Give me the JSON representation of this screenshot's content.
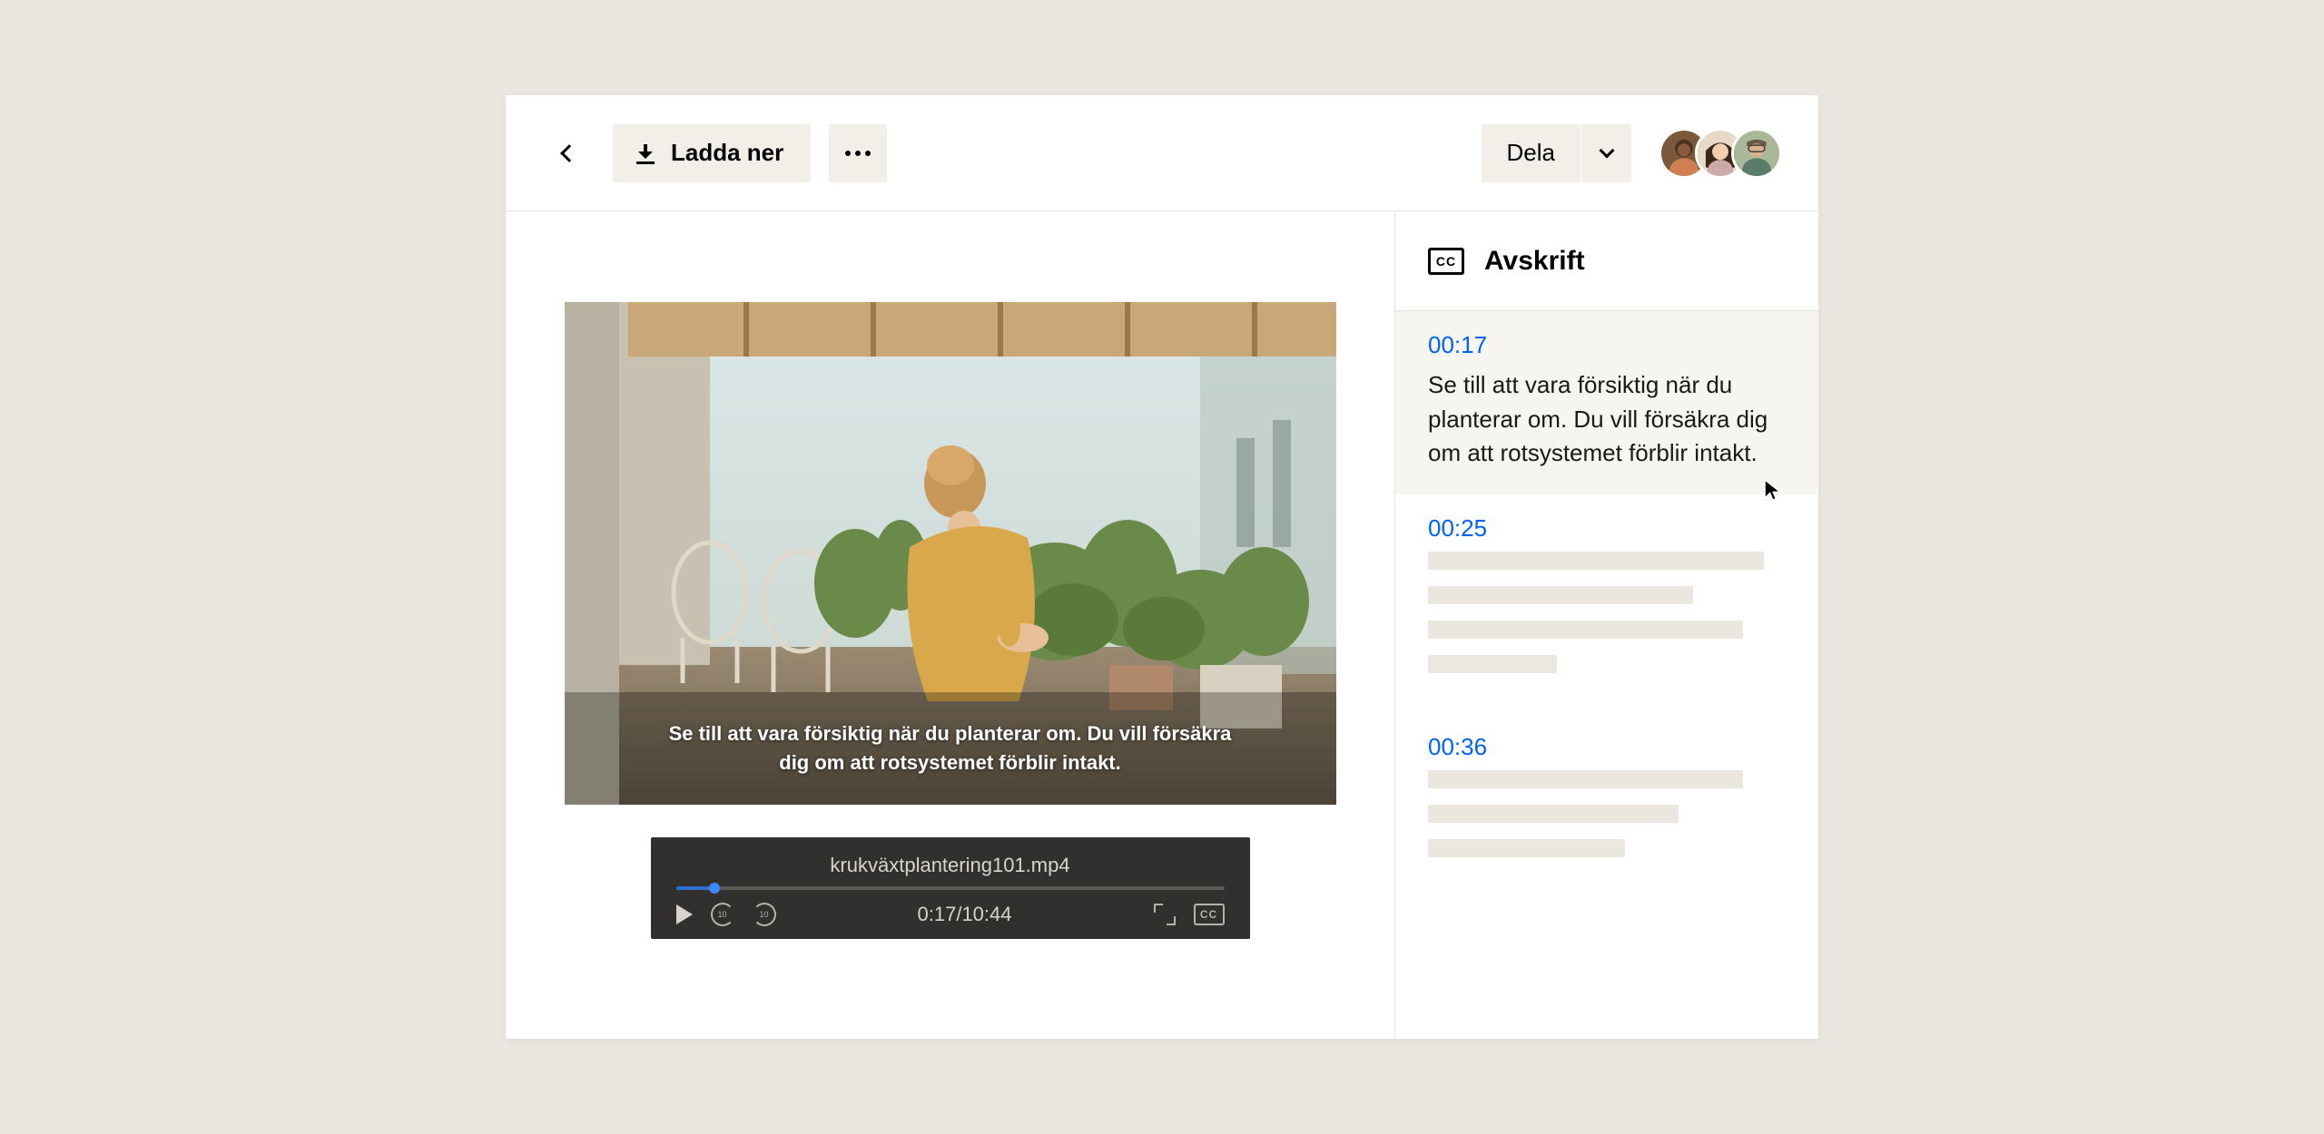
{
  "header": {
    "download_label": "Ladda ner",
    "share_label": "Dela"
  },
  "video": {
    "caption": "Se till att vara försiktig när du planterar om. Du vill försäkra dig om att rotsystemet förblir intakt.",
    "filename": "krukväxtplantering101.mp4",
    "current_time": "0:17",
    "duration": "10:44",
    "progress_pct": 7,
    "skip_seconds": "10"
  },
  "transcript": {
    "title": "Avskrift",
    "cc_label": "CC",
    "entries": [
      {
        "time": "00:17",
        "text": "Se till att vara försiktig när du planterar om. Du vill försäkra dig om att rotsystemet förblir intakt.",
        "active": true
      },
      {
        "time": "00:25",
        "placeholder_widths": [
          94,
          74,
          88,
          36
        ]
      },
      {
        "time": "00:36",
        "placeholder_widths": [
          88,
          70,
          55
        ]
      }
    ]
  }
}
